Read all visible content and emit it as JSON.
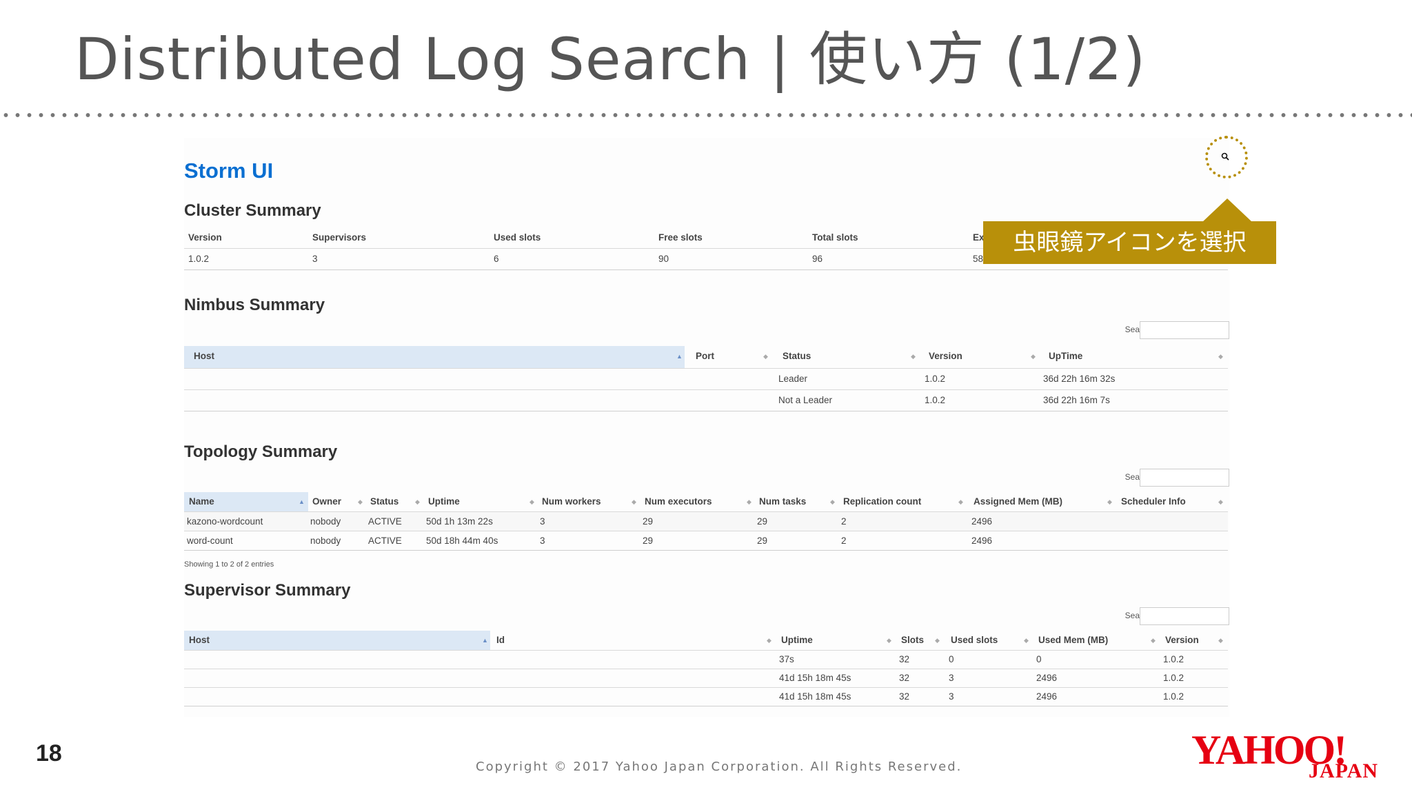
{
  "slide": {
    "title": "Distributed Log Search | 使い方 (1/2)",
    "page_number": "18",
    "copyright": "Copyright © 2017 Yahoo Japan Corporation. All Rights Reserved.",
    "callout_text": "虫眼鏡アイコンを選択",
    "logo_main": "YAHOO!",
    "logo_sub": "JAPAN",
    "accent_color": "#b8900a"
  },
  "storm": {
    "title": "Storm UI",
    "search_label": "Search:",
    "cluster": {
      "title": "Cluster Summary",
      "headers": [
        "Version",
        "Supervisors",
        "Used slots",
        "Free slots",
        "Total slots",
        "Ex"
      ],
      "row": [
        "1.0.2",
        "3",
        "6",
        "90",
        "96",
        "58"
      ]
    },
    "nimbus": {
      "title": "Nimbus Summary",
      "headers": [
        "Host",
        "Port",
        "Status",
        "Version",
        "UpTime"
      ],
      "rows": [
        [
          "",
          "",
          "Leader",
          "1.0.2",
          "36d 22h 16m 32s"
        ],
        [
          "",
          "",
          "Not a Leader",
          "1.0.2",
          "36d 22h 16m 7s"
        ]
      ]
    },
    "topology": {
      "title": "Topology Summary",
      "headers": [
        "Name",
        "Owner",
        "Status",
        "Uptime",
        "Num workers",
        "Num executors",
        "Num tasks",
        "Replication count",
        "Assigned Mem (MB)",
        "Scheduler Info"
      ],
      "rows": [
        [
          "kazono-wordcount",
          "nobody",
          "ACTIVE",
          "50d 1h 13m 22s",
          "3",
          "29",
          "29",
          "2",
          "2496",
          ""
        ],
        [
          "word-count",
          "nobody",
          "ACTIVE",
          "50d 18h 44m 40s",
          "3",
          "29",
          "29",
          "2",
          "2496",
          ""
        ]
      ],
      "showing": "Showing 1 to 2 of 2 entries"
    },
    "supervisor": {
      "title": "Supervisor Summary",
      "headers": [
        "Host",
        "Id",
        "Uptime",
        "Slots",
        "Used slots",
        "Used Mem (MB)",
        "Version"
      ],
      "rows": [
        [
          "",
          "",
          "37s",
          "32",
          "0",
          "0",
          "1.0.2"
        ],
        [
          "",
          "",
          "41d 15h 18m 45s",
          "32",
          "3",
          "2496",
          "1.0.2"
        ],
        [
          "",
          "",
          "41d 15h 18m 45s",
          "32",
          "3",
          "2496",
          "1.0.2"
        ]
      ]
    }
  }
}
